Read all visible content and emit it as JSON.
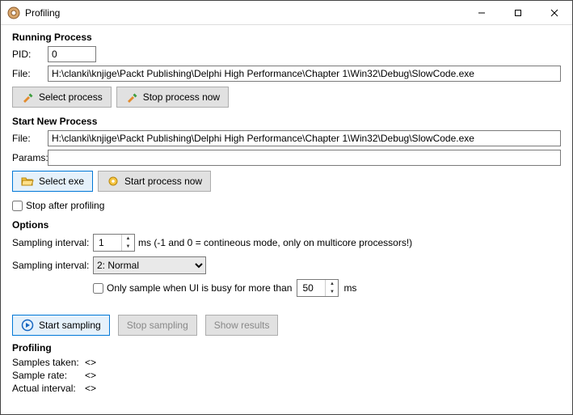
{
  "window": {
    "title": "Profiling"
  },
  "running": {
    "header": "Running Process",
    "pid_label": "PID:",
    "pid_value": "0",
    "file_label": "File:",
    "file_value": "H:\\clanki\\knjige\\Packt Publishing\\Delphi High Performance\\Chapter 1\\Win32\\Debug\\SlowCode.exe",
    "select_process_btn": "Select process",
    "stop_process_btn": "Stop process now"
  },
  "startnew": {
    "header": "Start New Process",
    "file_label": "File:",
    "file_value": "H:\\clanki\\knjige\\Packt Publishing\\Delphi High Performance\\Chapter 1\\Win32\\Debug\\SlowCode.exe",
    "params_label": "Params:",
    "params_value": "",
    "select_exe_btn": "Select exe",
    "start_process_btn": "Start process now",
    "stop_after_label": "Stop after profiling"
  },
  "options": {
    "header": "Options",
    "interval_label": "Sampling interval:",
    "interval_value": "1",
    "interval_hint": "ms (-1 and 0 = contineous mode, only on multicore processors!)",
    "priority_label": "Sampling interval:",
    "priority_value": "2: Normal",
    "busy_label_a": "Only sample when UI is busy for more than",
    "busy_value": "50",
    "busy_label_b": "ms"
  },
  "actions": {
    "start": "Start sampling",
    "stop": "Stop sampling",
    "show": "Show results"
  },
  "profiling": {
    "header": "Profiling",
    "samples_label": "Samples taken:",
    "samples_value": "<>",
    "rate_label": "Sample rate:",
    "rate_value": "<>",
    "actual_label": "Actual interval:",
    "actual_value": "<>"
  }
}
